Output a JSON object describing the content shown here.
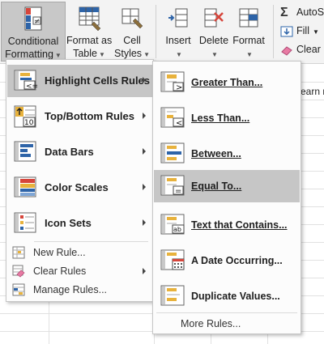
{
  "ribbon": {
    "conditional_formatting": {
      "line1": "Conditional",
      "line2": "Formatting"
    },
    "format_as_table": {
      "line1": "Format as",
      "line2": "Table"
    },
    "cell_styles": {
      "line1": "Cell",
      "line2": "Styles"
    },
    "insert": "Insert",
    "delete": "Delete",
    "format": "Format",
    "autosum": "AutoSu",
    "fill": "Fill",
    "clear": "Clear"
  },
  "sheet": {
    "partial_cell_text": "earn m"
  },
  "main_menu": {
    "items": [
      {
        "label": "Highlight Cells Rules",
        "icon": "highlight-cells-icon"
      },
      {
        "label": "Top/Bottom Rules",
        "icon": "top-bottom-icon"
      },
      {
        "label": "Data Bars",
        "icon": "data-bars-icon"
      },
      {
        "label": "Color Scales",
        "icon": "color-scales-icon"
      },
      {
        "label": "Icon Sets",
        "icon": "icon-sets-icon"
      }
    ],
    "small_items": [
      {
        "label": "New Rule...",
        "icon": "new-rule-icon"
      },
      {
        "label": "Clear Rules",
        "icon": "clear-rules-icon"
      },
      {
        "label": "Manage Rules...",
        "icon": "manage-rules-icon"
      }
    ]
  },
  "sub_menu": {
    "items": [
      {
        "label": "Greater Than...",
        "icon": "greater-than-icon"
      },
      {
        "label": "Less Than...",
        "icon": "less-than-icon"
      },
      {
        "label": "Between...",
        "icon": "between-icon"
      },
      {
        "label": "Equal To...",
        "icon": "equal-to-icon"
      },
      {
        "label": "Text that Contains...",
        "icon": "text-contains-icon"
      },
      {
        "label": "A Date Occurring...",
        "icon": "date-occurring-icon"
      },
      {
        "label": "Duplicate Values...",
        "icon": "duplicate-values-icon"
      }
    ],
    "more": "More Rules..."
  },
  "colors": {
    "highlight": "#c6c6c6",
    "accent_blue": "#2e64a8",
    "accent_orange": "#e8b23c",
    "accent_red": "#d6453b"
  }
}
